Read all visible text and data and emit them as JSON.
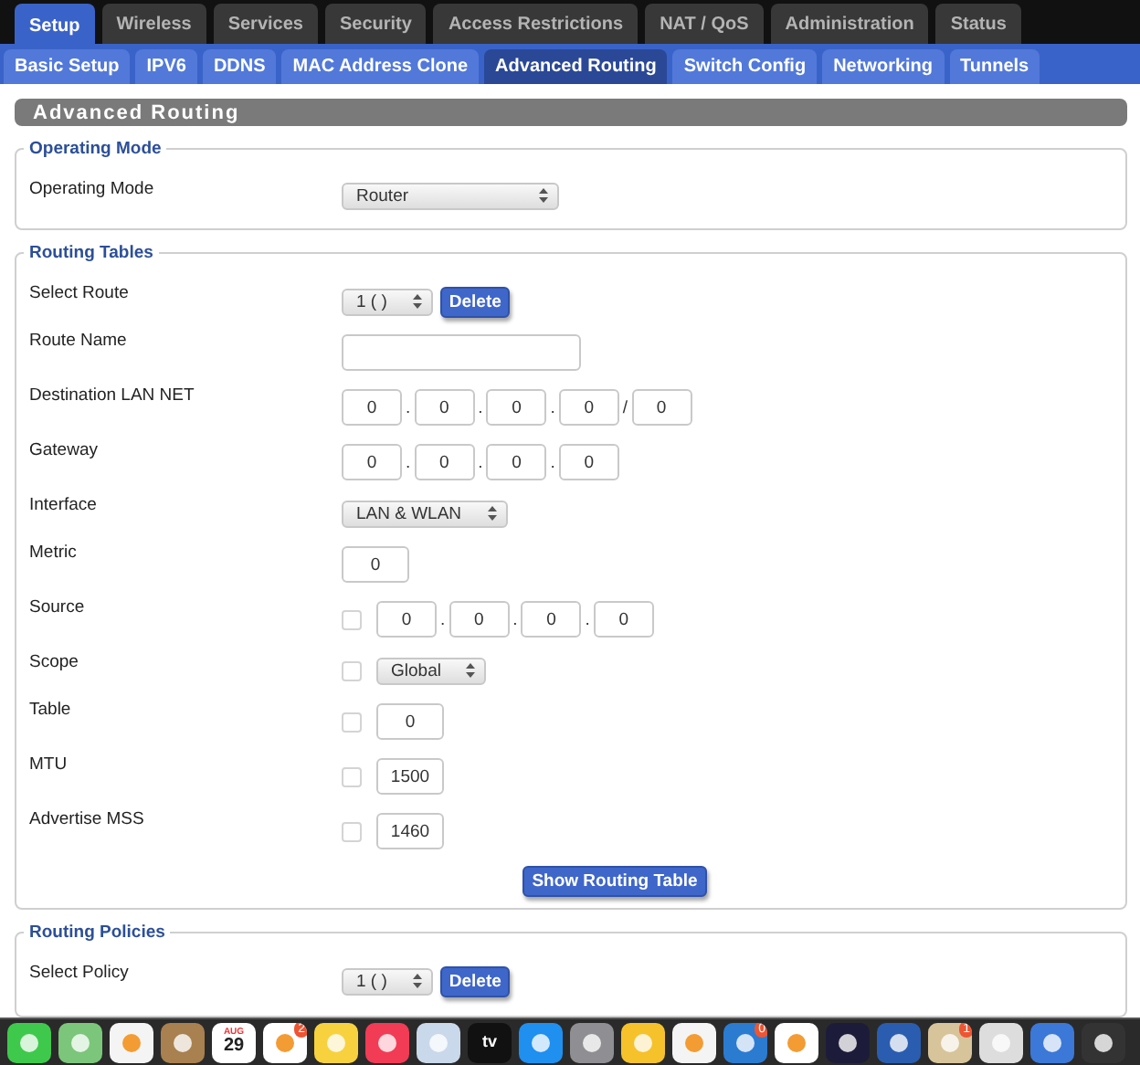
{
  "main_tabs": [
    {
      "label": "Setup",
      "selected": true
    },
    {
      "label": "Wireless",
      "selected": false
    },
    {
      "label": "Services",
      "selected": false
    },
    {
      "label": "Security",
      "selected": false
    },
    {
      "label": "Access Restrictions",
      "selected": false
    },
    {
      "label": "NAT / QoS",
      "selected": false
    },
    {
      "label": "Administration",
      "selected": false
    },
    {
      "label": "Status",
      "selected": false
    }
  ],
  "sub_tabs": [
    {
      "label": "Basic Setup",
      "selected": false
    },
    {
      "label": "IPV6",
      "selected": false
    },
    {
      "label": "DDNS",
      "selected": false
    },
    {
      "label": "MAC Address Clone",
      "selected": false
    },
    {
      "label": "Advanced Routing",
      "selected": true
    },
    {
      "label": "Switch Config",
      "selected": false
    },
    {
      "label": "Networking",
      "selected": false
    },
    {
      "label": "Tunnels",
      "selected": false
    }
  ],
  "section_title": "Advanced Routing",
  "fieldsets": [
    {
      "legend": "Operating Mode",
      "rows": [
        {
          "label": "Operating Mode",
          "control": {
            "kind": "wide_select",
            "value": "Router"
          }
        }
      ]
    },
    {
      "legend": "Routing Tables",
      "rows": [
        {
          "label": "Select Route",
          "control": {
            "kind": "select",
            "value": "1 ( )",
            "button": "Delete"
          }
        },
        {
          "label": "Route Name",
          "control": {
            "kind": "wide_text"
          }
        },
        {
          "label": "Destination LAN NET",
          "control": {
            "kind": "ip",
            "octets": [
              "0",
              "0",
              "0",
              "0"
            ],
            "dots": [
              ".",
              ".",
              "."
            ],
            "mask_separator": "/",
            "mask": "0"
          }
        },
        {
          "label": "Gateway",
          "control": {
            "kind": "ip",
            "octets": [
              "0",
              "0",
              "0",
              "0"
            ],
            "dots": [
              ".",
              ".",
              "."
            ]
          }
        },
        {
          "label": "Interface",
          "control": {
            "kind": "select",
            "value": "LAN & WLAN"
          }
        },
        {
          "label": "Metric",
          "control": {
            "kind": "text",
            "value": "0"
          }
        },
        {
          "label": "Source",
          "enable": {
            "checked": false
          },
          "control": {
            "kind": "ip",
            "octets": [
              "0",
              "0",
              "0",
              "0"
            ],
            "dots": [
              ".",
              ".",
              "."
            ]
          }
        },
        {
          "label": "Scope",
          "enable": {
            "checked": false
          },
          "control": {
            "kind": "select",
            "value": "Global"
          }
        },
        {
          "label": "Table",
          "enable": {
            "checked": false
          },
          "control": {
            "kind": "text",
            "value": "0"
          }
        },
        {
          "label": "MTU",
          "enable": {
            "checked": false
          },
          "control": {
            "kind": "text",
            "value": "1500"
          }
        },
        {
          "label": "Advertise MSS",
          "enable": {
            "checked": false
          },
          "control": {
            "kind": "text",
            "value": "1460"
          }
        }
      ],
      "button": "Show Routing Table"
    },
    {
      "legend": "Routing Policies",
      "rows": [
        {
          "label": "Select Policy",
          "control": {
            "kind": "select",
            "value": "1 ( )",
            "button": "Delete"
          }
        }
      ]
    }
  ],
  "dock": [
    {
      "kind": "messages"
    },
    {
      "kind": "maps"
    },
    {
      "kind": "photos"
    },
    {
      "kind": "contacts"
    },
    {
      "kind": "calendar",
      "month": "AUG",
      "day": "29"
    },
    {
      "kind": "reminders",
      "badge": "2"
    },
    {
      "kind": "notes"
    },
    {
      "kind": "music"
    },
    {
      "kind": "password"
    },
    {
      "kind": "tv",
      "label": "tv"
    },
    {
      "kind": "appstore"
    },
    {
      "kind": "settings"
    },
    {
      "kind": "duck"
    },
    {
      "kind": "grid"
    },
    {
      "kind": "wave",
      "badge": "0"
    },
    {
      "kind": "chat"
    },
    {
      "kind": "one"
    },
    {
      "kind": "compass"
    },
    {
      "kind": "package",
      "badge": "1"
    },
    {
      "kind": "foot"
    },
    {
      "kind": "globe"
    },
    {
      "kind": "film"
    }
  ]
}
